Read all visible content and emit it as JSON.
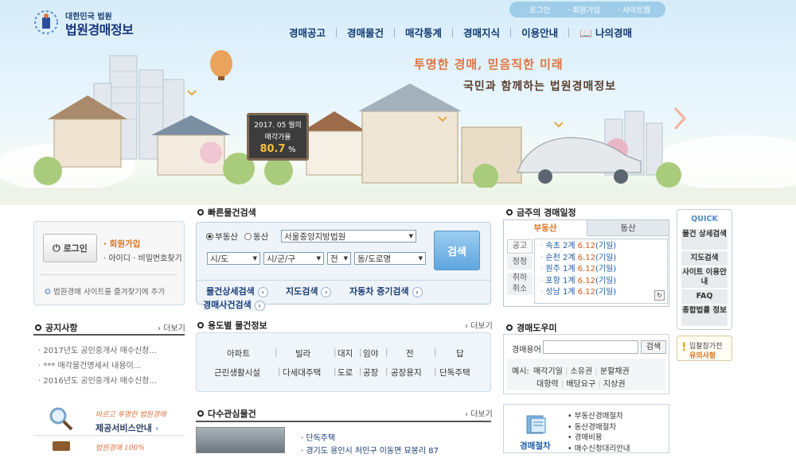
{
  "header": {
    "logo_small": "대한민국 법원",
    "logo_big": "법원경매정보",
    "util_links": [
      "로그인",
      "회원가입",
      "사이트맵"
    ],
    "gnb": [
      "경매공고",
      "경매물건",
      "매각통계",
      "경매지식",
      "이용안내",
      "나의경매"
    ]
  },
  "hero": {
    "slogan1": "투명한 경매, 믿음직한 미래",
    "slogan2": "국민과 함께하는 법원경매정보",
    "billboard_period": "2017. 05 월의",
    "billboard_label": "매각가율",
    "billboard_value": "80.7",
    "billboard_unit": "%"
  },
  "login": {
    "button": "로그인",
    "join": "회원가입",
    "find": "아이디 · 비밀번호찾기",
    "bookmark": "법원경매 사이트를 즐겨찾기에 추가"
  },
  "notice": {
    "title": "공지사항",
    "more": "더보기",
    "items": [
      "2017년도 공인중개사 매수신청...",
      "*** 매각물건명세서 내용이...",
      "2016년도 공인중개사 매수신청..."
    ]
  },
  "banners": {
    "b1_slogan": "바르고 투명한 법원경매",
    "b1_title": "제공서비스안내",
    "b2_slogan": "법원경매 100%"
  },
  "quick": {
    "title": "빠른물건검색",
    "radio1": "부동산",
    "radio2": "동산",
    "court": "서울중앙지방법원",
    "sido": "시/도",
    "sigungu": "시/군/구",
    "jeon": "전",
    "dong": "동/도로명",
    "search": "검색",
    "links": [
      "물건상세검색",
      "지도검색",
      "자동차 중기검색",
      "경매사건검색"
    ]
  },
  "usage": {
    "title": "용도별 물건정보",
    "more": "더보기",
    "row1": [
      "아파트",
      "빌라",
      "대지",
      "임야",
      "전",
      "답"
    ],
    "row2": [
      "근린생활시설",
      "다세대주택",
      "도로",
      "공장",
      "공장용지",
      "단독주택"
    ]
  },
  "interest": {
    "title": "다수관심물건",
    "more": "더보기",
    "items": [
      "단독주택",
      "경기도 용인시 처인구 이동면 묘봉리 87"
    ]
  },
  "schedule": {
    "title": "금주의 경매일정",
    "tab_active": "부동산",
    "tab_inactive": "동산",
    "left_labels": [
      "공고",
      "정정",
      "취하",
      "취소"
    ],
    "rows": [
      {
        "loc": "속초",
        "n": "2계",
        "date": "6.12",
        "type": "(기일)"
      },
      {
        "loc": "순천",
        "n": "2계",
        "date": "6.12",
        "type": "(기일)"
      },
      {
        "loc": "원주",
        "n": "1계",
        "date": "6.12",
        "type": "(기일)"
      },
      {
        "loc": "포항",
        "n": "1계",
        "date": "6.12",
        "type": "(기일)"
      },
      {
        "loc": "성남",
        "n": "1계",
        "date": "6.12",
        "type": "(기일)"
      }
    ]
  },
  "helper": {
    "title": "경매도우미",
    "label": "경매용어",
    "search": "검색",
    "example": "예시:",
    "terms1": [
      "매각기일",
      "소유권",
      "분할채권"
    ],
    "terms2": [
      "대항력",
      "배당요구",
      "지상권"
    ]
  },
  "procedure": {
    "label": "경매절차",
    "items": [
      "부동산경매절차",
      "동산경매절차",
      "경매비용",
      "매수신청대리안내"
    ]
  },
  "quickmenu": {
    "title": "QUICK",
    "items": [
      "물건 상세검색",
      "지도검색",
      "사이트 이용안내",
      "FAQ",
      "종합법률 정보"
    ],
    "notice_l1": "입찰참가전",
    "notice_l2": "유의사항"
  },
  "colors": {
    "navy": "#123a72",
    "accent": "#e0733f",
    "blue": "#1b5ba8",
    "date": "#d25a1a"
  }
}
